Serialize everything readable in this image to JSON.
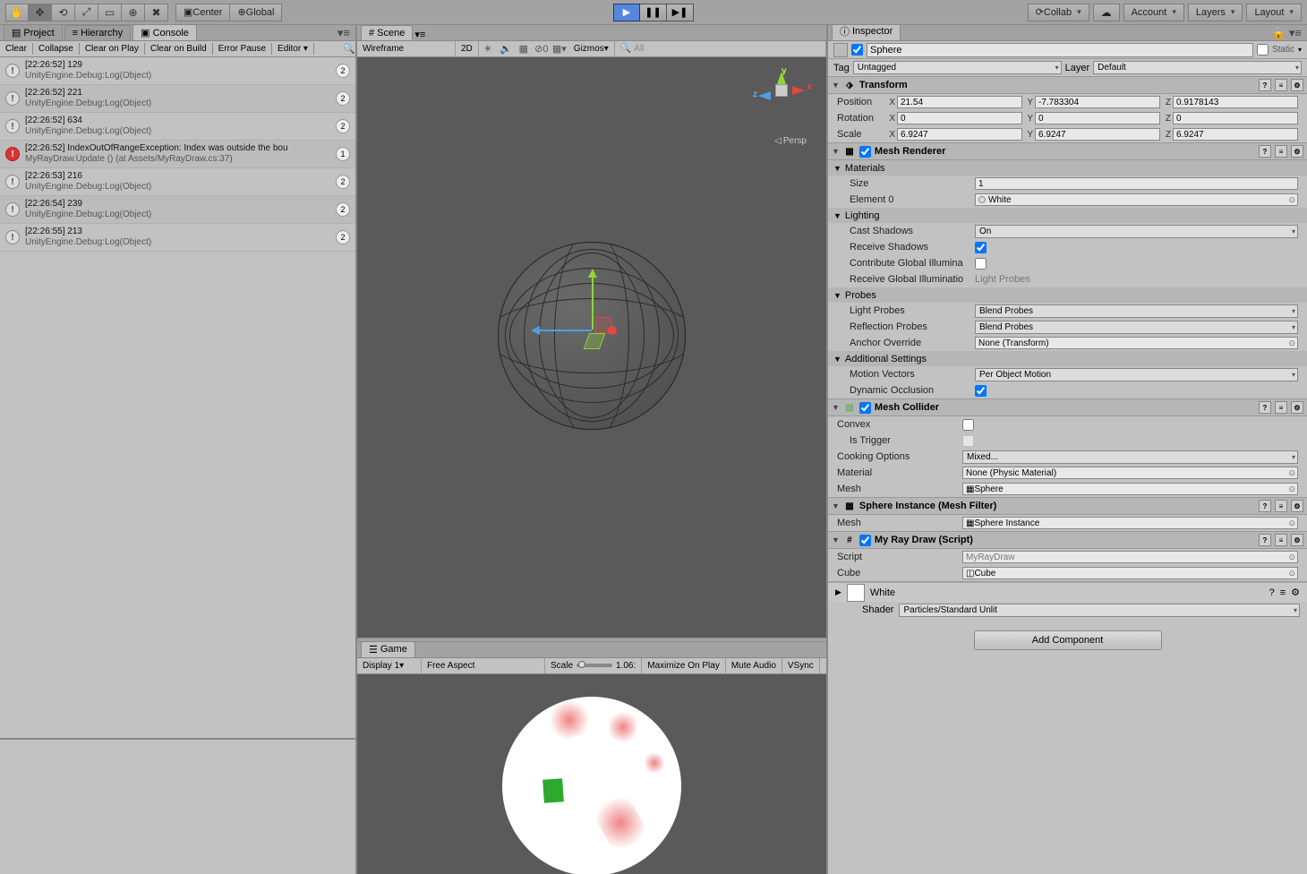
{
  "toolbar": {
    "center": "Center",
    "global": "Global",
    "collab": "Collab",
    "account": "Account",
    "layers": "Layers",
    "layout": "Layout"
  },
  "left": {
    "tabs": {
      "project": "Project",
      "hierarchy": "Hierarchy",
      "console": "Console"
    },
    "console_btns": {
      "clear": "Clear",
      "collapse": "Collapse",
      "clear_play": "Clear on Play",
      "clear_build": "Clear on Build",
      "error_pause": "Error Pause",
      "editor": "Editor"
    },
    "logs": [
      {
        "type": "info",
        "line1": "[22:26:52] 129",
        "line2": "UnityEngine.Debug:Log(Object)",
        "count": "2"
      },
      {
        "type": "info",
        "line1": "[22:26:52] 221",
        "line2": "UnityEngine.Debug:Log(Object)",
        "count": "2"
      },
      {
        "type": "info",
        "line1": "[22:26:52] 634",
        "line2": "UnityEngine.Debug:Log(Object)",
        "count": "2"
      },
      {
        "type": "err",
        "line1": "[22:26:52] IndexOutOfRangeException: Index was outside the bou",
        "line2": "MyRayDraw.Update () (at Assets/MyRayDraw.cs:37)",
        "count": "1"
      },
      {
        "type": "info",
        "line1": "[22:26:53] 216",
        "line2": "UnityEngine.Debug:Log(Object)",
        "count": "2"
      },
      {
        "type": "info",
        "line1": "[22:26:54] 239",
        "line2": "UnityEngine.Debug:Log(Object)",
        "count": "2"
      },
      {
        "type": "info",
        "line1": "[22:26:55] 213",
        "line2": "UnityEngine.Debug:Log(Object)",
        "count": "2"
      }
    ]
  },
  "scene": {
    "tab": "Scene",
    "shading": "Wireframe",
    "twod": "2D",
    "gizmos": "Gizmos",
    "search_ph": "All",
    "persp": "Persp"
  },
  "game": {
    "tab": "Game",
    "display": "Display 1",
    "aspect": "Free Aspect",
    "scale_lbl": "Scale",
    "scale_val": "1.06:",
    "max": "Maximize On Play",
    "mute": "Mute Audio",
    "vsync": "VSync"
  },
  "inspector": {
    "tab": "Inspector",
    "name": "Sphere",
    "static": "Static",
    "tag_lbl": "Tag",
    "tag": "Untagged",
    "layer_lbl": "Layer",
    "layer": "Default",
    "transform": {
      "title": "Transform",
      "position": "Position",
      "rotation": "Rotation",
      "scale": "Scale",
      "px": "21.54",
      "py": "-7.783304",
      "pz": "0.9178143",
      "rx": "0",
      "ry": "0",
      "rz": "0",
      "sx": "6.9247",
      "sy": "6.9247",
      "sz": "6.9247"
    },
    "renderer": {
      "title": "Mesh Renderer",
      "materials": "Materials",
      "size_lbl": "Size",
      "size": "1",
      "elem0_lbl": "Element 0",
      "elem0": "White",
      "lighting": "Lighting",
      "cast": "Cast Shadows",
      "cast_v": "On",
      "receive": "Receive Shadows",
      "contrib": "Contribute Global Illumina",
      "recv_gi": "Receive Global Illuminatio",
      "recv_gi_v": "Light Probes",
      "probes": "Probes",
      "light_probes": "Light Probes",
      "light_probes_v": "Blend Probes",
      "refl": "Reflection Probes",
      "refl_v": "Blend Probes",
      "anchor": "Anchor Override",
      "anchor_v": "None (Transform)",
      "addl": "Additional Settings",
      "motion": "Motion Vectors",
      "motion_v": "Per Object Motion",
      "dyn": "Dynamic Occlusion"
    },
    "collider": {
      "title": "Mesh Collider",
      "convex": "Convex",
      "trigger": "Is Trigger",
      "cook": "Cooking Options",
      "cook_v": "Mixed...",
      "mat": "Material",
      "mat_v": "None (Physic Material)",
      "mesh": "Mesh",
      "mesh_v": "Sphere"
    },
    "filter": {
      "title": "Sphere Instance (Mesh Filter)",
      "mesh": "Mesh",
      "mesh_v": "Sphere Instance"
    },
    "script": {
      "title": "My Ray Draw (Script)",
      "script": "Script",
      "script_v": "MyRayDraw",
      "cube": "Cube",
      "cube_v": "Cube"
    },
    "material": {
      "name": "White",
      "shader_lbl": "Shader",
      "shader": "Particles/Standard Unlit"
    },
    "add": "Add Component"
  }
}
